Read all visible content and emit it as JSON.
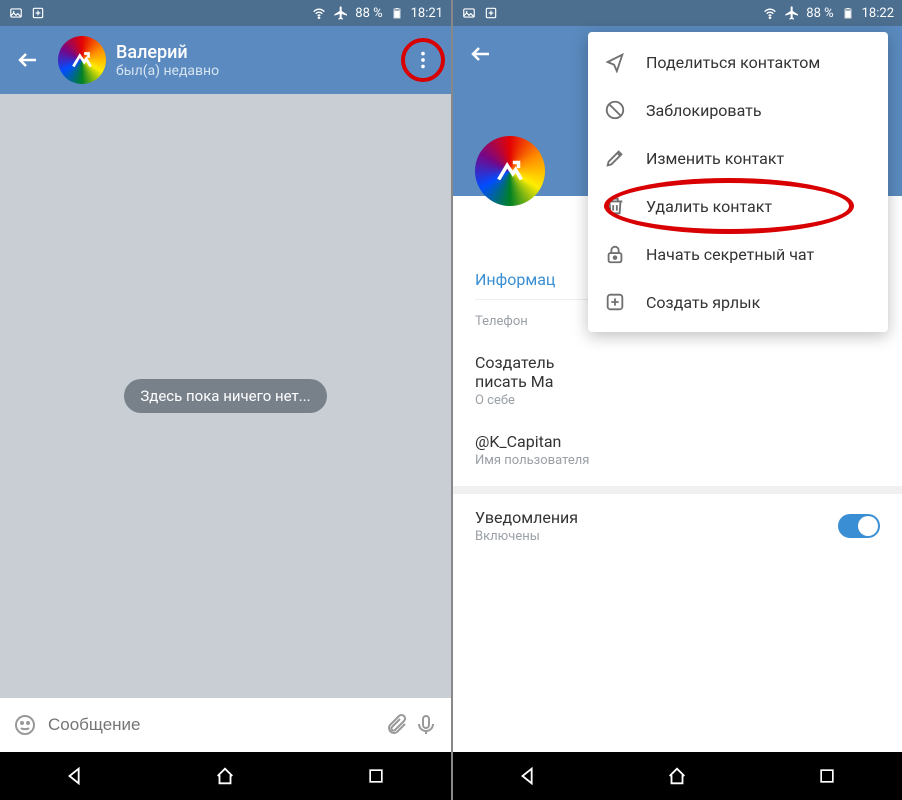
{
  "statusbar": {
    "battery": "88 %",
    "time_left": "18:21",
    "time_right": "18:22"
  },
  "chat": {
    "name": "Валерий",
    "status": "был(а) недавно",
    "empty_msg": "Здесь пока ничего нет...",
    "input_placeholder": "Сообщение"
  },
  "profile": {
    "info_tab": "Информац",
    "phone_label": "Телефон",
    "bio_value": "Создатель\nписать Ма",
    "bio_label": "О себе",
    "username_value": "@K_Capitan",
    "username_label": "Имя пользователя",
    "notif_title": "Уведомления",
    "notif_status": "Включены"
  },
  "menu": {
    "share": "Поделиться контактом",
    "block": "Заблокировать",
    "edit": "Изменить контакт",
    "delete": "Удалить контакт",
    "secret": "Начать секретный чат",
    "shortcut": "Создать ярлык"
  }
}
